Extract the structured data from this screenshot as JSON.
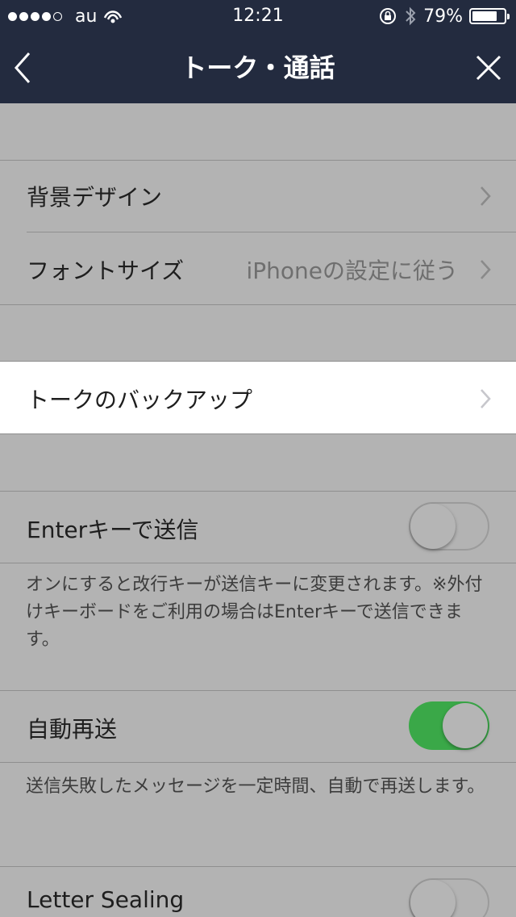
{
  "status_bar": {
    "carrier": "au",
    "time": "12:21",
    "battery_percent": "79%",
    "battery_level": 0.79,
    "icons": [
      "signal-dots-icon",
      "wifi-icon",
      "orientation-lock-icon",
      "bluetooth-icon",
      "battery-icon"
    ]
  },
  "nav": {
    "title": "トーク・通話",
    "back_icon": "chevron-left-icon",
    "close_icon": "close-icon"
  },
  "section1": {
    "background_label": "背景デザイン",
    "font_size_label": "フォントサイズ",
    "font_size_value": "iPhoneの設定に従う"
  },
  "section2": {
    "backup_label": "トークのバックアップ"
  },
  "enter_send": {
    "label": "Enterキーで送信",
    "enabled": false,
    "footnote": "オンにすると改行キーが送信キーに変更されます。※外付けキーボードをご利用の場合はEnterキーで送信できます。"
  },
  "auto_resend": {
    "label": "自動再送",
    "enabled": true,
    "footnote": "送信失敗したメッセージを一定時間、自動で再送します。"
  },
  "letter_sealing": {
    "label": "Letter Sealing",
    "enabled": false
  },
  "colors": {
    "nav_background": "#232b3f",
    "toggle_on": "#3aa848",
    "dimmed_background": "#b3b3b3"
  }
}
